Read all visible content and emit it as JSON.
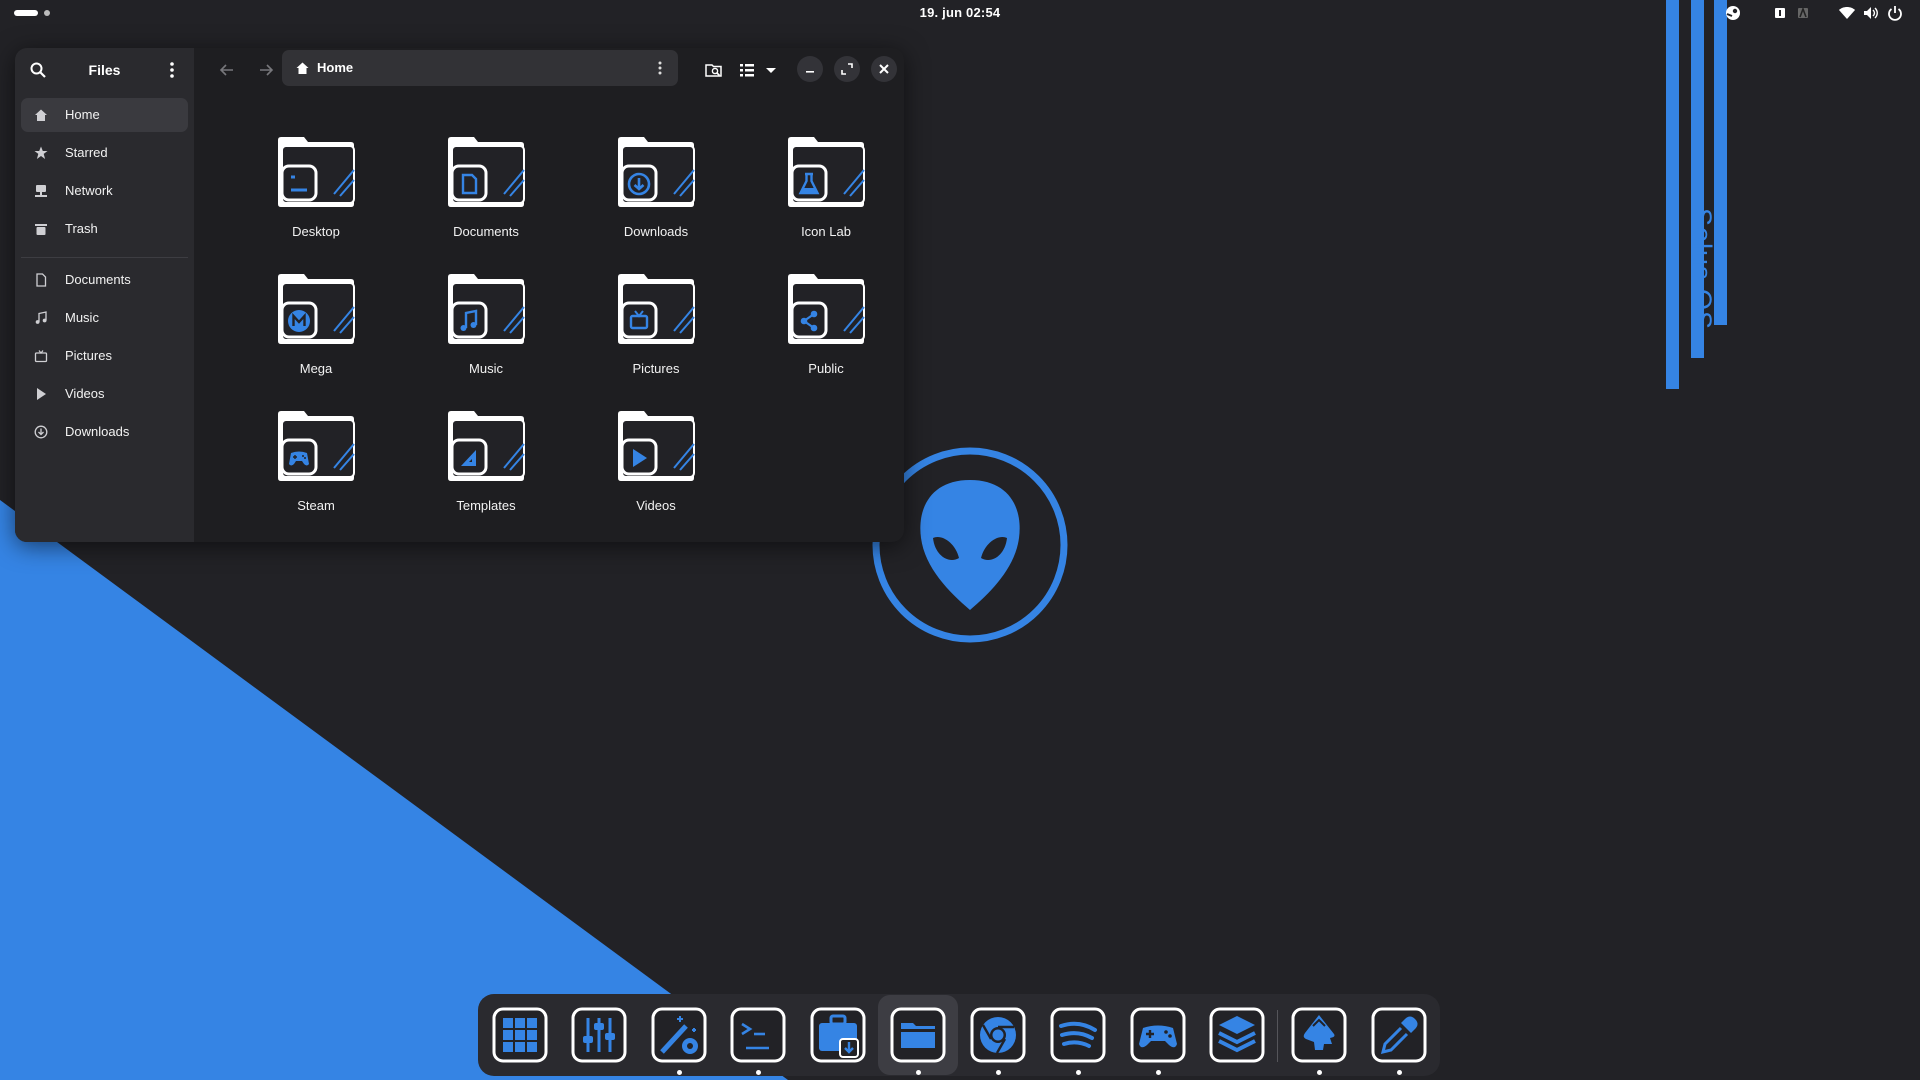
{
  "topbar": {
    "clock": "19. jun  02:54",
    "tray_icons": [
      "steam-icon",
      "info-icon",
      "keyboard-layout-icon",
      "wifi-icon",
      "volume-icon",
      "power-icon"
    ]
  },
  "window": {
    "sidebar": {
      "title": "Files",
      "items": [
        {
          "label": "Home",
          "icon": "home-icon",
          "active": true
        },
        {
          "label": "Starred",
          "icon": "star-icon"
        },
        {
          "label": "Network",
          "icon": "network-icon"
        },
        {
          "label": "Trash",
          "icon": "trash-icon"
        },
        {
          "label": "Documents",
          "icon": "document-icon"
        },
        {
          "label": "Music",
          "icon": "music-icon"
        },
        {
          "label": "Pictures",
          "icon": "picture-icon"
        },
        {
          "label": "Videos",
          "icon": "play-icon"
        },
        {
          "label": "Downloads",
          "icon": "download-icon"
        }
      ]
    },
    "location": "Home",
    "folders": [
      {
        "label": "Desktop",
        "glyph": "desktop"
      },
      {
        "label": "Documents",
        "glyph": "document"
      },
      {
        "label": "Downloads",
        "glyph": "download"
      },
      {
        "label": "Icon Lab",
        "glyph": "flask"
      },
      {
        "label": "Mega",
        "glyph": "mega"
      },
      {
        "label": "Music",
        "glyph": "music"
      },
      {
        "label": "Pictures",
        "glyph": "picture"
      },
      {
        "label": "Public",
        "glyph": "share"
      },
      {
        "label": "Steam",
        "glyph": "gamepad"
      },
      {
        "label": "Templates",
        "glyph": "template"
      },
      {
        "label": "Videos",
        "glyph": "play"
      }
    ]
  },
  "desktop": {
    "brand_text": "Solus OS",
    "accent": "#3584e4",
    "background": "#222226"
  },
  "dock": {
    "apps": [
      {
        "name": "app-grid-icon",
        "running": false
      },
      {
        "name": "mixer-settings-icon",
        "running": false
      },
      {
        "name": "tweaks-wand-icon",
        "running": true
      },
      {
        "name": "terminal-icon",
        "running": true
      },
      {
        "name": "software-center-icon",
        "running": false
      },
      {
        "name": "files-icon",
        "running": true,
        "active": true
      },
      {
        "name": "chrome-icon",
        "running": true
      },
      {
        "name": "spotify-icon",
        "running": true
      },
      {
        "name": "gamepad-icon",
        "running": true
      },
      {
        "name": "stack-layers-icon",
        "running": false
      },
      {
        "name": "inkscape-icon",
        "running": true
      },
      {
        "name": "color-picker-icon",
        "running": true
      }
    ]
  }
}
